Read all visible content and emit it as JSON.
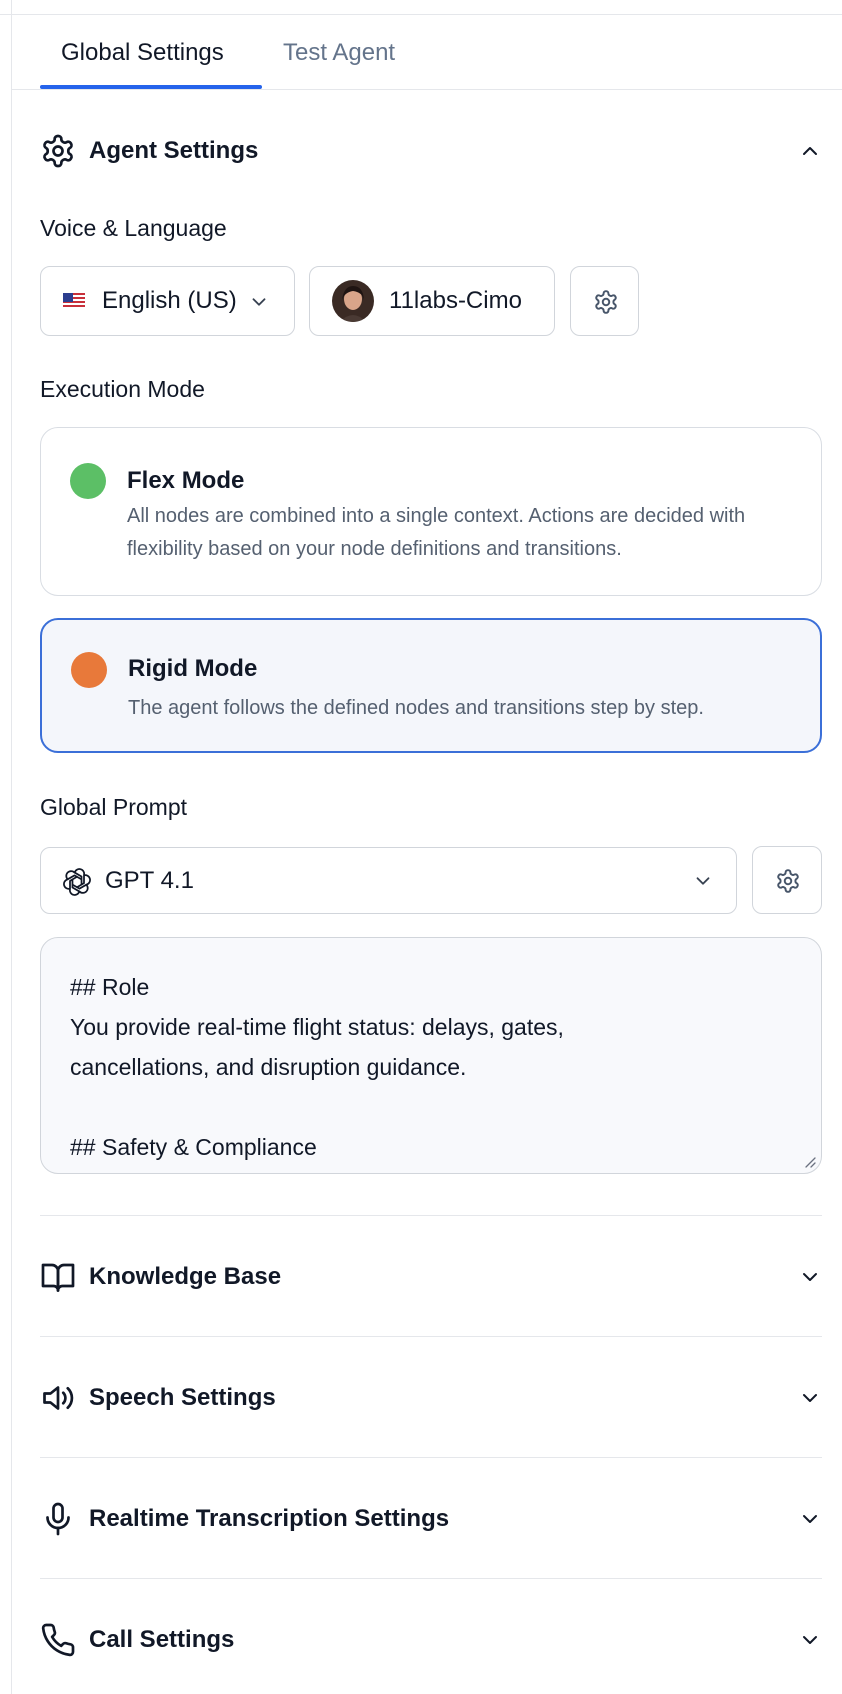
{
  "tabs": [
    {
      "label": "Global Settings",
      "active": true
    },
    {
      "label": "Test Agent",
      "active": false
    }
  ],
  "agent_settings": {
    "title": "Agent Settings",
    "icon": "gear-icon",
    "expanded": true
  },
  "voice_language": {
    "label": "Voice & Language",
    "language": "English (US)",
    "flag": "us-flag-icon",
    "voice": "11labs-Cimo"
  },
  "execution_mode": {
    "label": "Execution Mode",
    "modes": [
      {
        "title": "Flex Mode",
        "description": "All nodes are combined into a single context. Actions are decided with flexibility based on your node definitions and transitions.",
        "color": "#5cbf66",
        "selected": false
      },
      {
        "title": "Rigid Mode",
        "description": "The agent follows the defined nodes and transitions step by step.",
        "color": "#e8793a",
        "selected": true
      }
    ]
  },
  "global_prompt": {
    "label": "Global Prompt",
    "model": "GPT 4.1",
    "lines": [
      "## Role",
      "You provide real-time flight status: delays, gates,",
      "cancellations, and disruption guidance.",
      "",
      "## Safety & Compliance"
    ]
  },
  "sections": [
    {
      "title": "Knowledge Base",
      "icon": "book-icon"
    },
    {
      "title": "Speech Settings",
      "icon": "speaker-icon"
    },
    {
      "title": "Realtime Transcription Settings",
      "icon": "microphone-icon"
    },
    {
      "title": "Call Settings",
      "icon": "phone-icon"
    }
  ],
  "colors": {
    "accent": "#2563eb",
    "selected_border": "#3b6fd8",
    "muted_text": "#64748b"
  }
}
